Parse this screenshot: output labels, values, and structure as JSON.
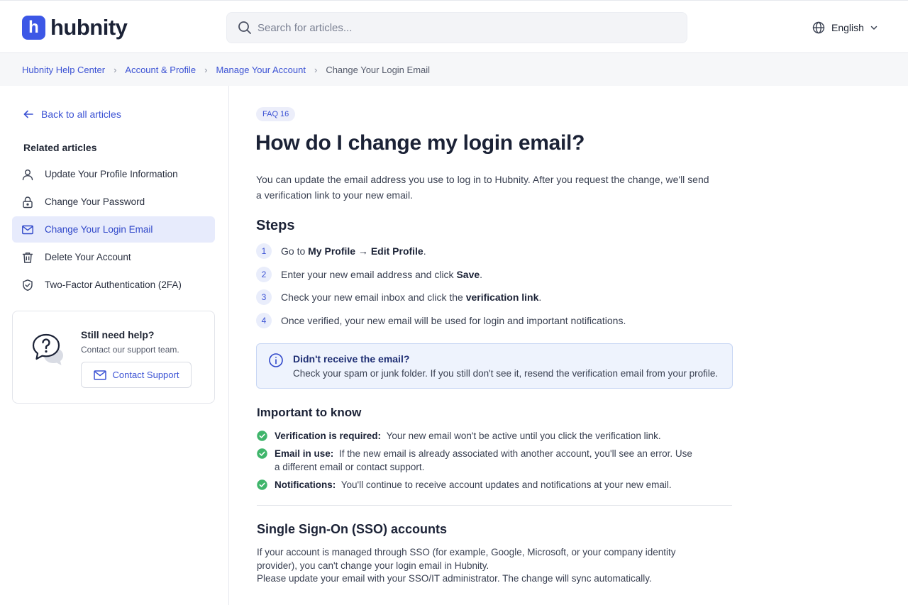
{
  "header": {
    "logo_letter": "h",
    "logo_text": "hubnity",
    "search_placeholder": "Search for articles...",
    "language": "English"
  },
  "breadcrumb": {
    "items": [
      "Hubnity Help Center",
      "Account & Profile",
      "Manage Your Account"
    ],
    "current": "Change Your Login Email"
  },
  "sidebar": {
    "back_label": "Back to all articles",
    "related_title": "Related articles",
    "related": [
      {
        "label": "Update Your Profile Information",
        "icon": "user-icon"
      },
      {
        "label": "Change Your Password",
        "icon": "lock-icon"
      },
      {
        "label": "Change Your Login Email",
        "icon": "mail-icon",
        "active": true
      },
      {
        "label": "Delete Your Account",
        "icon": "trash-icon"
      },
      {
        "label": "Two-Factor Authentication (2FA)",
        "icon": "shield-icon"
      }
    ],
    "help": {
      "title": "Still need help?",
      "subtitle": "Contact our support team.",
      "button": "Contact Support"
    }
  },
  "article": {
    "badge": "FAQ 16",
    "title": "How do I change my login email?",
    "intro": "You can update the email address you use to log in to Hubnity. After you request the change, we'll send a verification link to your new email.",
    "steps_title": "Steps",
    "steps": [
      {
        "num": "1",
        "pre": "Go to ",
        "bold": "My Profile → Edit Profile",
        "post": "."
      },
      {
        "num": "2",
        "pre": "Enter your new email address and click ",
        "bold": "Save",
        "post": "."
      },
      {
        "num": "3",
        "pre": "Check your new email inbox and click the ",
        "bold": "verification link",
        "post": "."
      },
      {
        "num": "4",
        "pre": "Once verified, your new email will be used for login and important notifications.",
        "bold": "",
        "post": ""
      }
    ],
    "notice": {
      "title": "Didn't receive the email?",
      "text": "Check your spam or junk folder. If you still don't see it, resend the verification email from your profile."
    },
    "know_title": "Important to know",
    "know": [
      {
        "bold": "Verification is required:",
        "text": "Your new email won't be active until you click the verification link."
      },
      {
        "bold": "Email in use:",
        "text": "If the new email is already associated with another account, you'll see an error. Use a different email or contact support."
      },
      {
        "bold": "Notifications:",
        "text": "You'll continue to receive account updates and notifications at your new email."
      }
    ],
    "sso_title": "Single Sign-On (SSO) accounts",
    "sso_text": "If your account is managed through SSO (for example, Google, Microsoft, or your company identity provider), you can't change your login email in Hubnity.",
    "sso_text2": "Please update your email with your SSO/IT administrator. The change will sync automatically."
  },
  "colors": {
    "accent": "#3c57e6",
    "link": "#3b52d4",
    "success": "#3fb56b"
  }
}
